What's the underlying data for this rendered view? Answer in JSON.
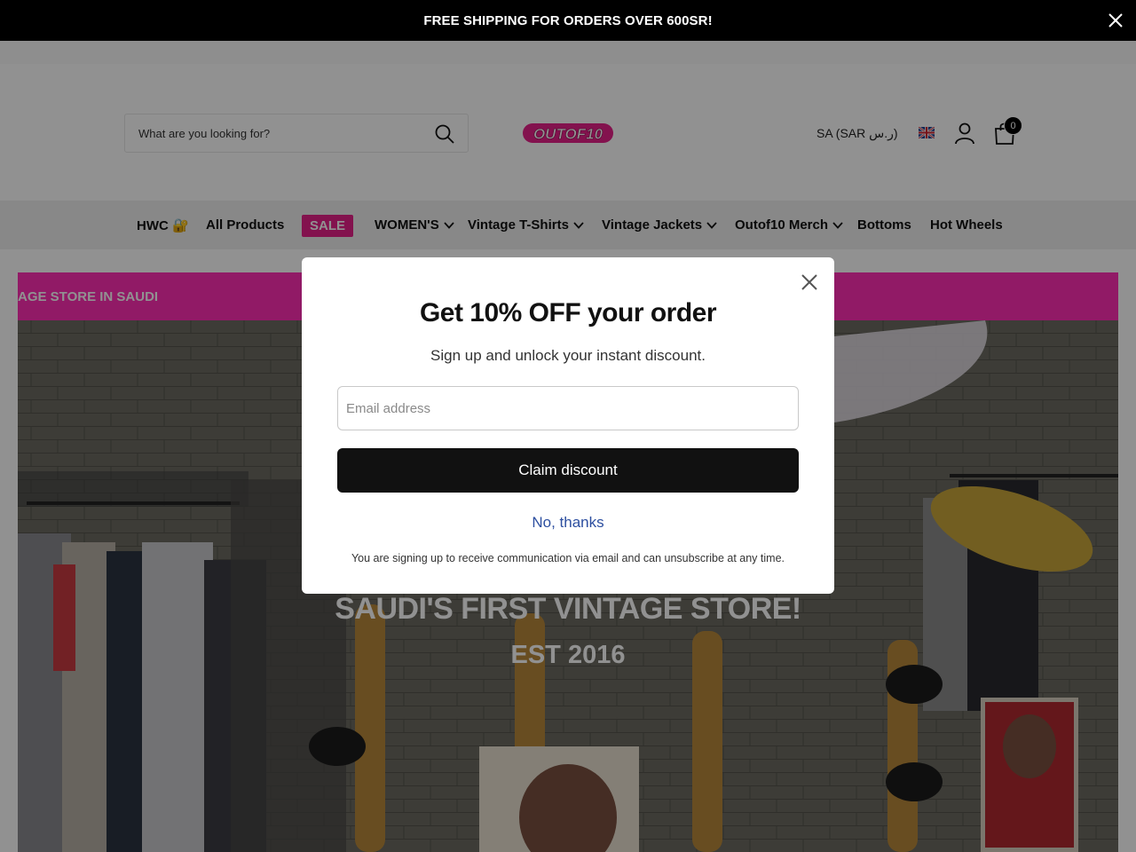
{
  "announcement": {
    "text": "FREE SHIPPING FOR ORDERS OVER 600SR!"
  },
  "header": {
    "search_placeholder": "What are you looking for?",
    "logo_text": "OUTOF10",
    "currency_label": "SA (SAR ر.س)",
    "cart_count": "0"
  },
  "nav": {
    "items": [
      {
        "label": "HWC 🔐"
      },
      {
        "label": "All Products"
      },
      {
        "label": "SALE"
      },
      {
        "label": "WOMEN'S"
      },
      {
        "label": "Vintage T-Shirts"
      },
      {
        "label": "Vintage Jackets"
      },
      {
        "label": "Outof10 Merch"
      },
      {
        "label": "Bottoms"
      },
      {
        "label": "Hot Wheels"
      }
    ]
  },
  "marquee": {
    "text": "AGE STORE IN SAUDI"
  },
  "hero": {
    "title": "SAUDI'S FIRST VINTAGE STORE!",
    "subtitle": "EST 2016"
  },
  "popup": {
    "title": "Get 10% OFF your order",
    "subtitle": "Sign up and unlock your instant discount.",
    "email_placeholder": "Email address",
    "claim_label": "Claim discount",
    "decline_label": "No, thanks",
    "fine_print": "You are signing up to receive communication via email and can unsubscribe at any time."
  },
  "colors": {
    "brand_pink": "#e6218a",
    "marquee_pink": "#ff2fb4",
    "announcement_bg": "#000000",
    "button_dark": "#111111",
    "link_blue": "#2d4fa0"
  }
}
